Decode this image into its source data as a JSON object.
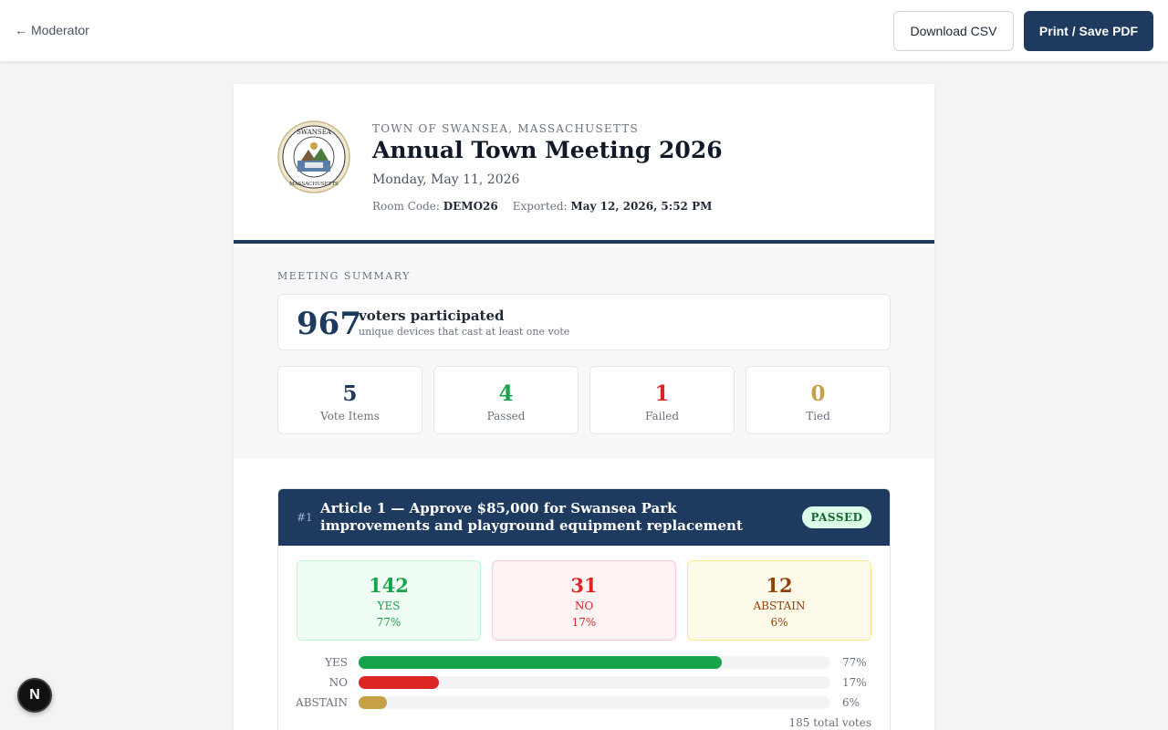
{
  "topbar": {
    "back_label": "Moderator",
    "csv_label": "Download CSV",
    "pdf_label": "Print / Save PDF"
  },
  "header": {
    "town": "TOWN OF SWANSEA, MASSACHUSETTS",
    "title": "Annual Town Meeting 2026",
    "date": "Monday, May 11, 2026",
    "room_code_label": "Room Code:",
    "room_code": "DEMO26",
    "exported_label": "Exported:",
    "exported": "May 12, 2026, 5:52 PM",
    "seal_text_top": "SWANSEA",
    "seal_text_bottom": "MASSACHUSETTS"
  },
  "summary": {
    "label": "MEETING SUMMARY",
    "participants": "967",
    "participants_title": "voters participated",
    "participants_sub": "unique devices that cast at least one vote",
    "stats": [
      {
        "value": "5",
        "label": "Vote Items",
        "color": "#1e3a5f"
      },
      {
        "value": "4",
        "label": "Passed",
        "color": "#16a34a"
      },
      {
        "value": "1",
        "label": "Failed",
        "color": "#dc2626"
      },
      {
        "value": "0",
        "label": "Tied",
        "color": "#c5a046"
      }
    ]
  },
  "article": {
    "number": "#1",
    "title": "Article 1 — Approve $85,000 for Swansea Park improvements and playground equipment replacement",
    "status": "PASSED",
    "tallies": [
      {
        "count": "142",
        "label": "YES",
        "pct": "77%",
        "fg": "#16a34a",
        "bg": "#f0fdf4",
        "border": "#bbf7d0"
      },
      {
        "count": "31",
        "label": "NO",
        "pct": "17%",
        "fg": "#dc2626",
        "bg": "#fef2f2",
        "border": "#fecaca"
      },
      {
        "count": "12",
        "label": "ABSTAIN",
        "pct": "6%",
        "fg": "#92400e",
        "bg": "#fffbeb",
        "border": "#fde68a"
      }
    ],
    "bars": [
      {
        "label": "YES",
        "pct": "77%",
        "value": 0.77,
        "color": "#16a34a"
      },
      {
        "label": "NO",
        "pct": "17%",
        "value": 0.17,
        "color": "#dc2626"
      },
      {
        "label": "ABSTAIN",
        "pct": "6%",
        "value": 0.06,
        "color": "#c5a046"
      }
    ],
    "total": "185 total votes"
  },
  "fab_label": "N"
}
